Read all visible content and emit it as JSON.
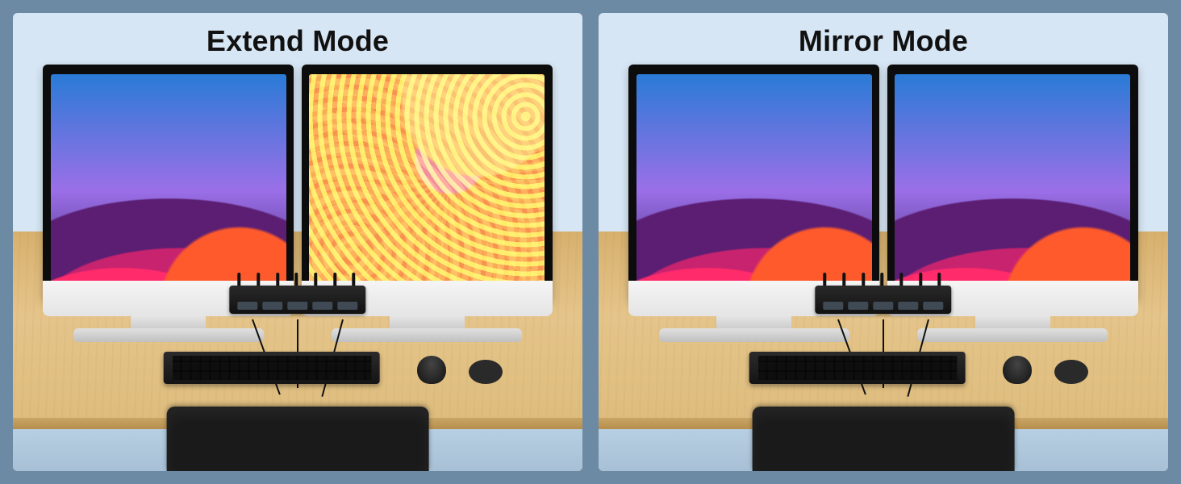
{
  "panels": [
    {
      "title": "Extend Mode",
      "left_screen": "bigsur",
      "right_screen": "abstract"
    },
    {
      "title": "Mirror Mode",
      "left_screen": "bigsur",
      "right_screen": "bigsur"
    }
  ]
}
